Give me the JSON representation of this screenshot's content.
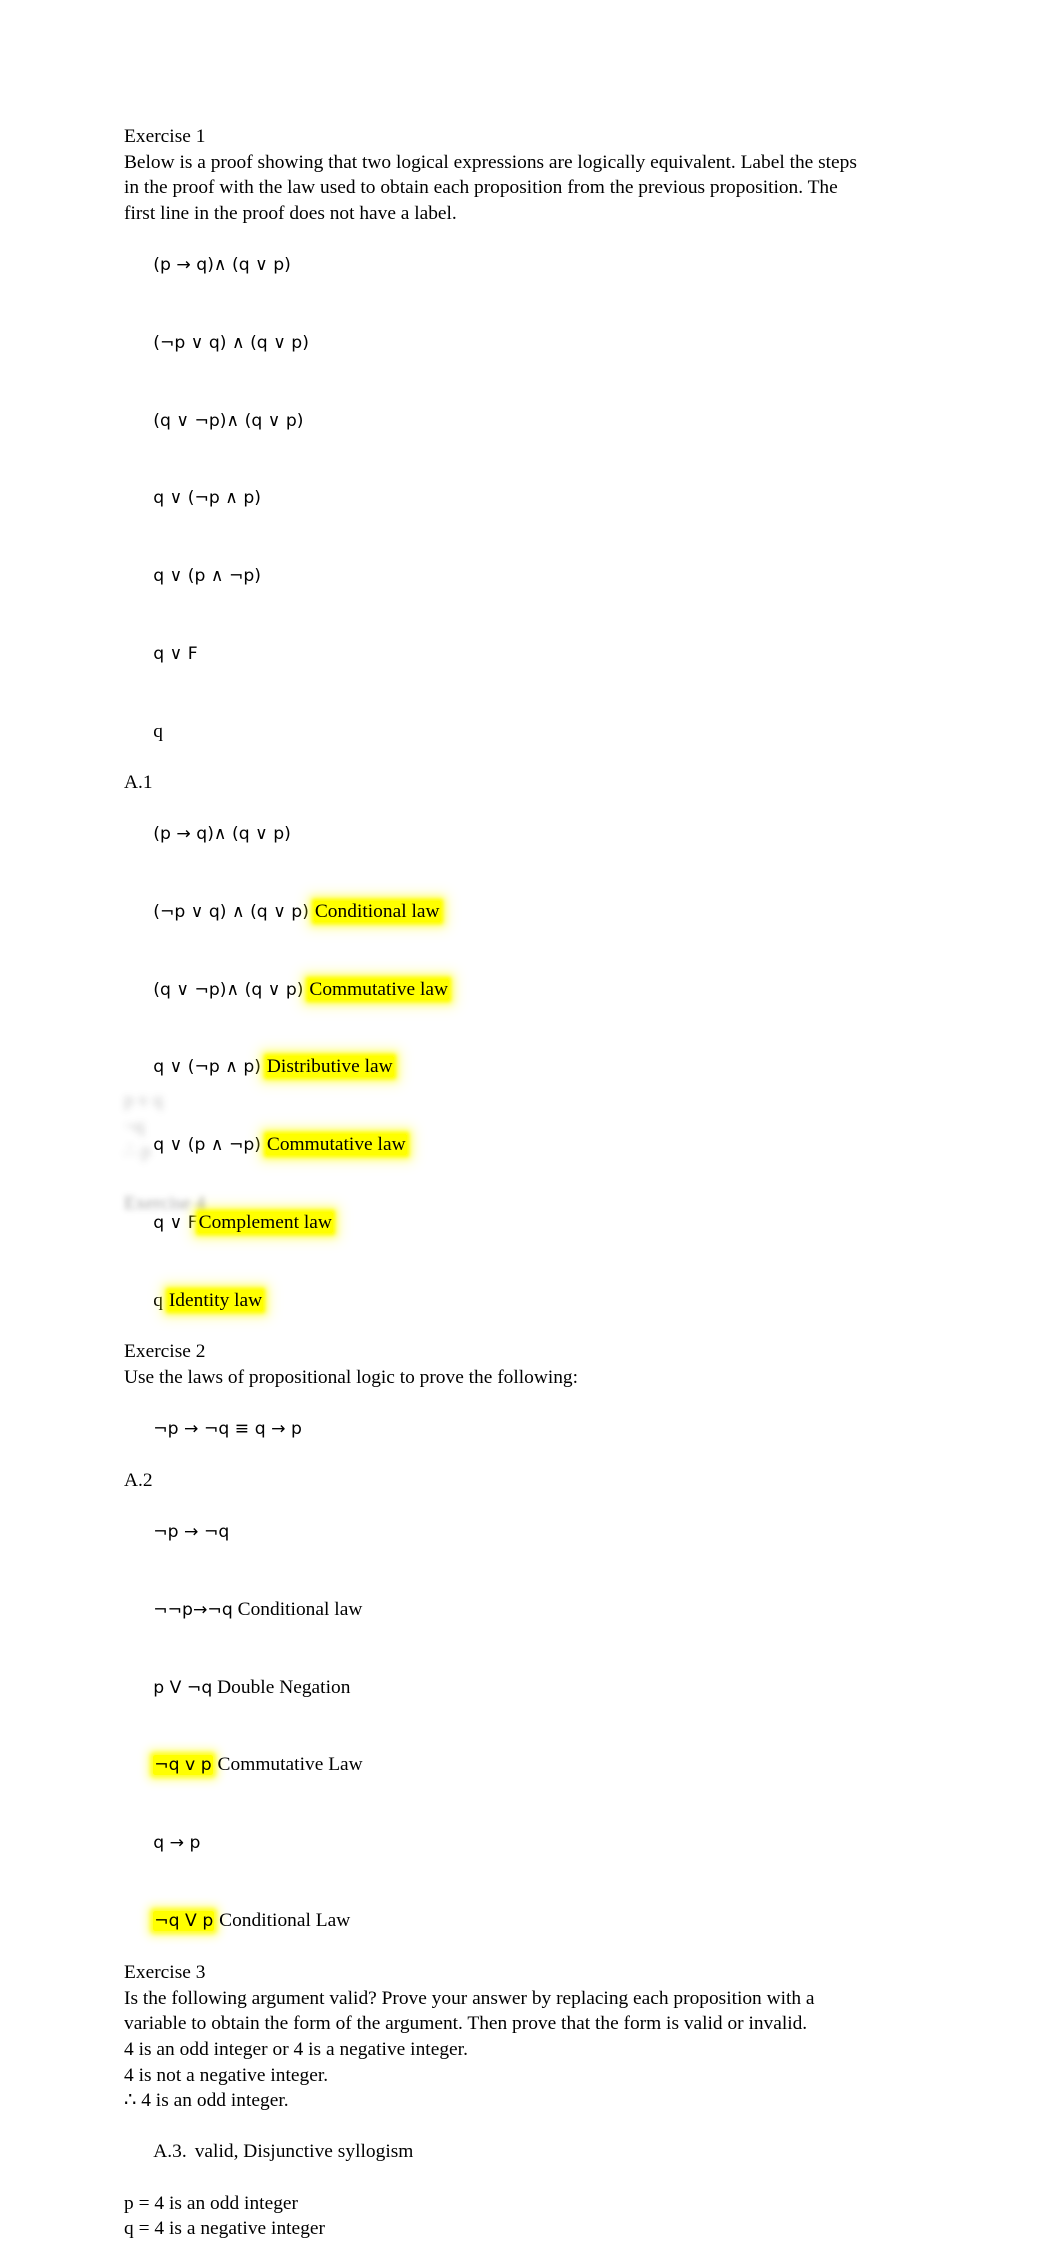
{
  "document": {
    "background_color": "#ffffff",
    "text_color": "#000000",
    "highlight_color": "#ffff00"
  },
  "exercise1": {
    "heading": "Exercise 1",
    "prompt": "Below is a proof showing that two logical expressions are logically equivalent. Label the steps in the proof with the law used to obtain each proposition from the previous proposition. The first line in the proof does not have a label.",
    "given_proof": [
      "(p → q)∧ (q ∨ p)",
      "(¬p ∨ q) ∧ (q ∨ p)",
      "(q ∨ ¬p)∧ (q ∨ p)",
      "q ∨ (¬p ∧ p)",
      "q ∨ (p ∧ ¬p)",
      "q ∨ F",
      "q"
    ],
    "answer_label": "A.1",
    "answer_steps": [
      {
        "expression": "(p → q)∧ (q ∨ p)",
        "law": "",
        "highlighted": false
      },
      {
        "expression": "(¬p ∨ q) ∧ (q ∨ p)",
        "law": "Conditional law",
        "highlighted": true
      },
      {
        "expression": "(q ∨ ¬p)∧ (q ∨ p)",
        "law": "Commutative law",
        "highlighted": true
      },
      {
        "expression": "q ∨ (¬p ∧ p)",
        "law": "Distributive law",
        "highlighted": true
      },
      {
        "expression": "q ∨ (p ∧ ¬p)",
        "law": "Commutative law",
        "highlighted": true
      },
      {
        "expression": "q ∨ F",
        "law": "Complement law",
        "highlighted": true
      },
      {
        "expression": "q",
        "law": "Identity law",
        "highlighted": true
      }
    ]
  },
  "exercise2": {
    "heading": "Exercise 2",
    "prompt": "Use the laws of propositional logic to prove the following:",
    "statement": "¬p → ¬q ≡ q → p",
    "answer_label": "A.2",
    "answer_steps": [
      {
        "expression": "¬p → ¬q",
        "law": "",
        "highlighted": false
      },
      {
        "expression": "¬¬p→¬q",
        "law": "Conditional law",
        "highlighted": false
      },
      {
        "expression": "p V ¬q",
        "law": "Double Negation",
        "highlighted": false
      },
      {
        "expression": "¬q v p",
        "law": "Commutative Law",
        "highlighted": true
      },
      {
        "expression": "q → p",
        "law": "",
        "highlighted": false
      },
      {
        "expression": "¬q V p",
        "law": "Conditional Law",
        "highlighted": true
      }
    ]
  },
  "exercise3": {
    "heading": "Exercise 3",
    "prompt": "Is the following argument valid? Prove your answer by replacing each proposition with a variable to obtain the form of the argument. Then prove that the form is valid or invalid.",
    "premise1": "4 is an odd integer or 4 is a negative integer.",
    "premise2": "4 is not a negative integer.",
    "conclusion": "∴ 4 is an odd integer.",
    "answer_label": "A.3.",
    "answer_text": "valid, Disjunctive syllogism",
    "variable_definitions": [
      "p = 4 is an odd integer",
      "q = 4 is a negative integer"
    ]
  },
  "obscured": {
    "note": "faded illegible text block at bottom of page",
    "lines": [
      "p v q",
      "¬q",
      "∴ p"
    ],
    "trailing_line": "Exercise 4"
  }
}
